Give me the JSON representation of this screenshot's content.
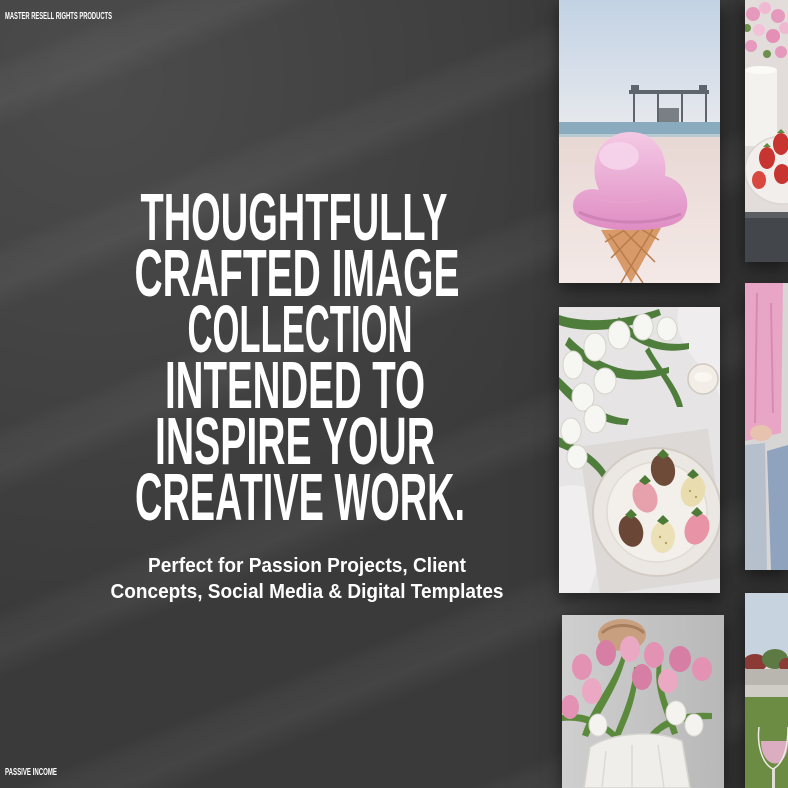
{
  "header": {
    "tag": "MASTER RESELL RIGHTS PRODUCTS"
  },
  "headline": {
    "lines": [
      "THOUGHTFULLY",
      "CRAFTED IMAGE",
      "COLLECTION",
      "INTENDED TO",
      "INSPIRE YOUR",
      "CREATIVE WORK."
    ]
  },
  "subheadline": {
    "lines": [
      "Perfect for Passion Projects, Client",
      "Concepts, Social Media & Digital Templates"
    ]
  },
  "footer": {
    "tag": "PASSIVE INCOME"
  },
  "colors": {
    "background": "#3a3a3a",
    "text": "#ffffff"
  }
}
